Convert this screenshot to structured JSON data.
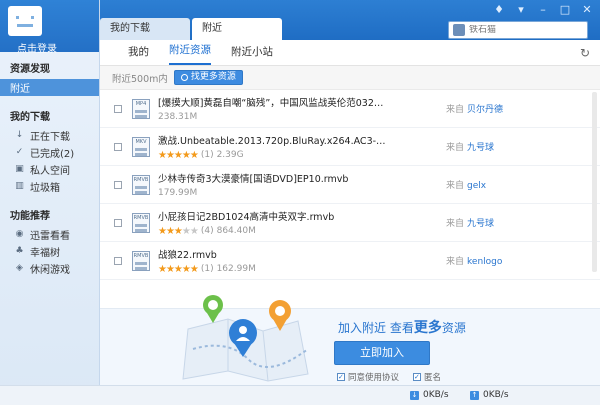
{
  "sidebar": {
    "login": "点击登录",
    "section1": "资源发现",
    "nearby": "附近",
    "section2": "我的下载",
    "items": [
      {
        "label": "正在下载",
        "icon": "download-arrow-icon"
      },
      {
        "label": "已完成(2)",
        "icon": "check-icon"
      },
      {
        "label": "私人空间",
        "icon": "lock-icon"
      },
      {
        "label": "垃圾箱",
        "icon": "trash-icon"
      }
    ],
    "section3": "功能推荐",
    "features": [
      {
        "label": "迅雷看看",
        "icon": "eye-icon"
      },
      {
        "label": "幸福树",
        "icon": "tree-icon"
      },
      {
        "label": "休闲游戏",
        "icon": "gamepad-icon"
      }
    ]
  },
  "tabs": [
    "我的下载",
    "附近"
  ],
  "search": {
    "placeholder": "铁石猫"
  },
  "subtabs": [
    "我的",
    "附近资源",
    "附近小站"
  ],
  "filter": {
    "label": "附近500m内",
    "button": "找更多资源"
  },
  "files": [
    {
      "icon_label": "MP4",
      "name": "[爆摸大顺]黄磊自嘲“脑残”，中国风监战英伦范0320上...",
      "rating": 0,
      "count": "",
      "size": "238.31M",
      "from_label": "来自",
      "from": "贝尔丹德"
    },
    {
      "icon_label": "MKV",
      "name": "激战.Unbeatable.2013.720p.BluRay.x264.AC3-CNXP.m...",
      "rating": 5,
      "count": "(1)",
      "size": "2.39G",
      "from_label": "来自",
      "from": "九号球"
    },
    {
      "icon_label": "RMVB",
      "name": "少林寺传奇3大漠豪情[国语DVD]EP10.rmvb",
      "rating": 0,
      "count": "",
      "size": "179.99M",
      "from_label": "来自",
      "from": "gelx"
    },
    {
      "icon_label": "RMVB",
      "name": "小屁孩日记2BD1024高清中英双字.rmvb",
      "rating": 3,
      "count": "(4)",
      "size": "864.40M",
      "from_label": "来自",
      "from": "九号球"
    },
    {
      "icon_label": "RMVB",
      "name": "战狼22.rmvb",
      "rating": 5,
      "count": "(1)",
      "size": "162.99M",
      "from_label": "来自",
      "from": "kenlogo"
    }
  ],
  "promo": {
    "title_pre": "加入附近 查看",
    "title_big": "更多",
    "title_post": "资源",
    "join": "立即加入",
    "agree1": "同意使用协议",
    "agree2": "匿名"
  },
  "status": {
    "down": "0KB/s",
    "up": "0KB/s"
  },
  "colors": {
    "accent": "#1d6fd1",
    "header": "#2a78cc",
    "star": "#f39a1b"
  }
}
